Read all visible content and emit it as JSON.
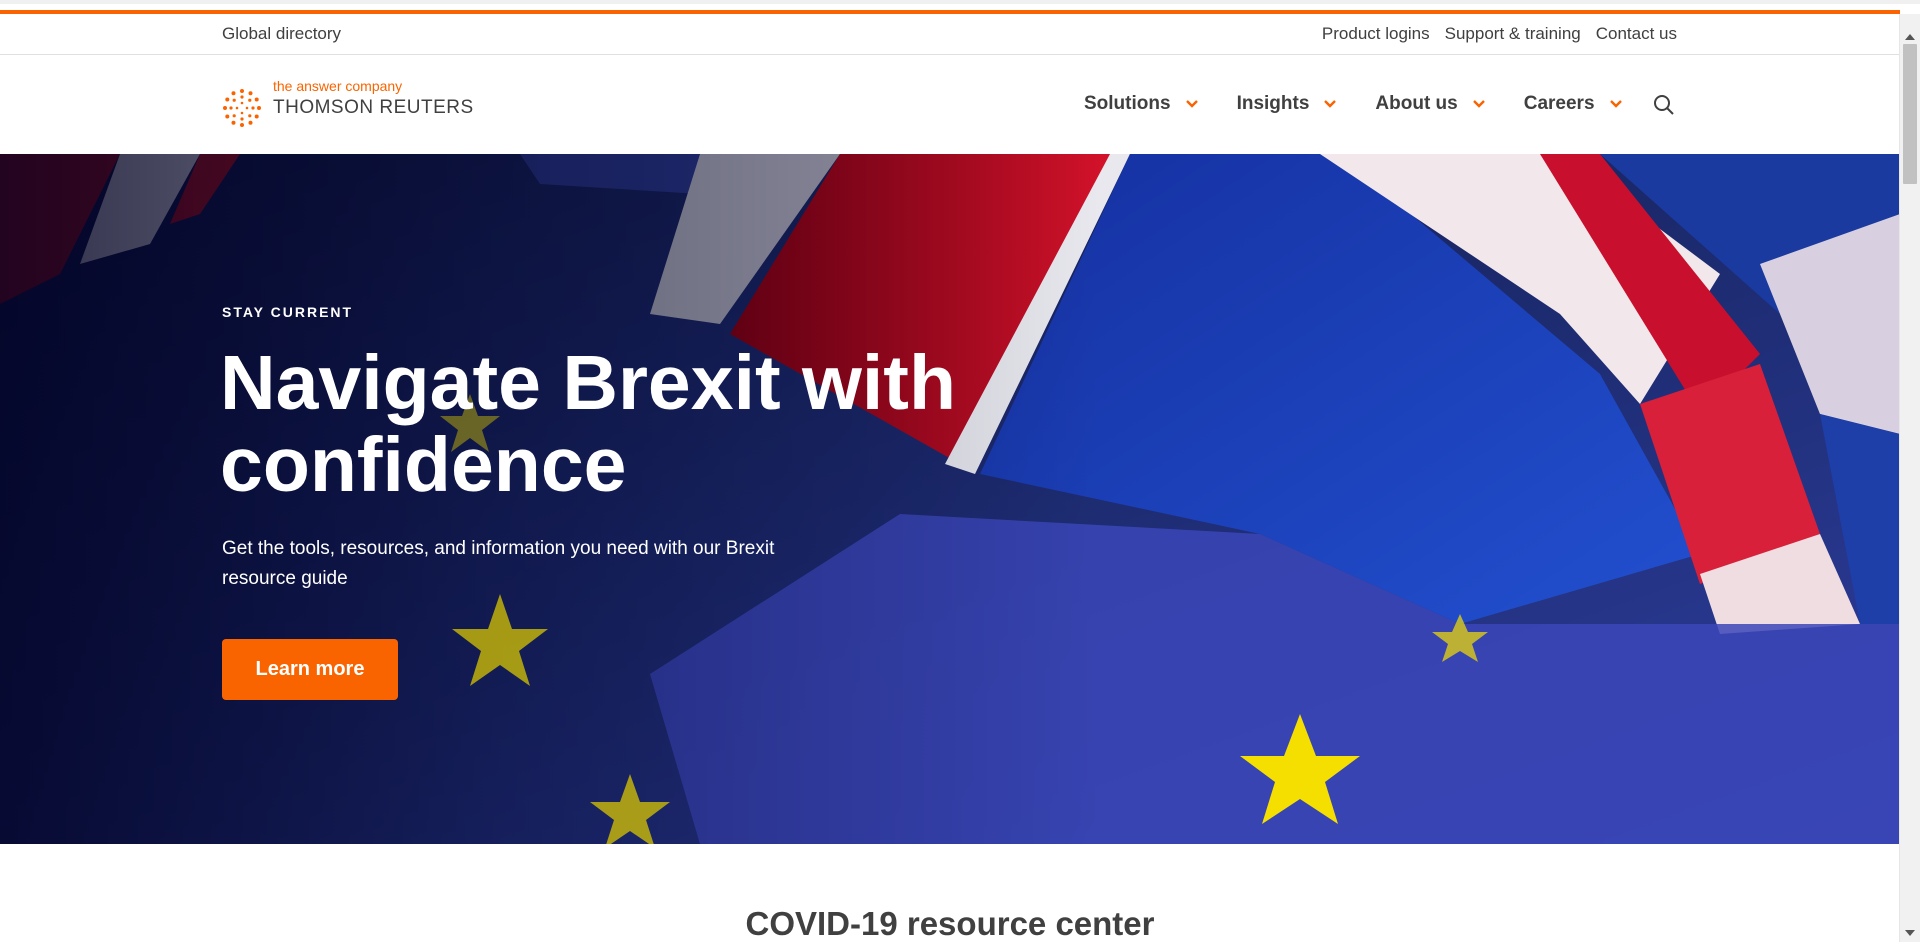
{
  "colors": {
    "accent": "#fa6400",
    "text": "#404040",
    "hero_navy": "#1a2560",
    "flag_red": "#c8102e",
    "flag_blue": "#1b3fa8",
    "eu_star": "#f5df00"
  },
  "utility_bar": {
    "global_directory": "Global directory",
    "links": [
      "Product logins",
      "Support & training",
      "Contact us"
    ]
  },
  "logo": {
    "tagline": "the answer company",
    "brand": "THOMSON REUTERS",
    "icon": "thomson-reuters-dots-logo"
  },
  "nav": {
    "items": [
      "Solutions",
      "Insights",
      "About us",
      "Careers"
    ],
    "item_icon": "chevron-down-icon",
    "search_icon": "search-icon"
  },
  "hero": {
    "eyebrow": "STAY CURRENT",
    "headline": "Navigate Brexit with confidence",
    "subtext": "Get the tools, resources, and information you need with our Brexit resource guide",
    "cta_label": "Learn more"
  },
  "section": {
    "title": "COVID-19 resource center"
  }
}
